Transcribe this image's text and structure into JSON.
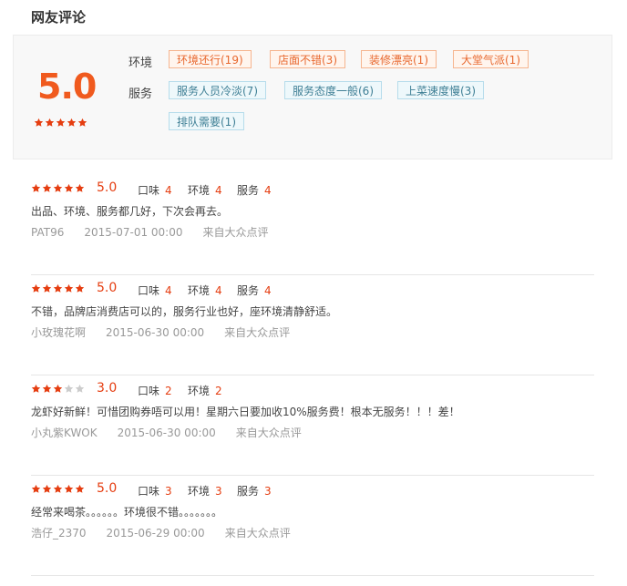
{
  "section_title": "网友评论",
  "summary": {
    "overall_score": "5.0",
    "overall_stars": 5,
    "environment_label": "环境",
    "service_label": "服务",
    "environment_tags": [
      "环境还行(19)",
      "店面不错(3)",
      "装修漂亮(1)",
      "大堂气派(1)"
    ],
    "service_tags": [
      "服务人员冷淡(7)",
      "服务态度一般(6)",
      "上菜速度慢(3)",
      "排队需要(1)"
    ]
  },
  "colors": {
    "accent": "#e53d10",
    "star_on": "#e53d10",
    "star_off": "#cccccc"
  },
  "reviews": [
    {
      "stars": 5,
      "score": "5.0",
      "metrics": [
        {
          "label": "口味",
          "value": "4"
        },
        {
          "label": "环境",
          "value": "4"
        },
        {
          "label": "服务",
          "value": "4"
        }
      ],
      "text": "出品、环境、服务都几好，下次会再去。",
      "user": "PAT96",
      "time": "2015-07-01 00:00",
      "source": "来自大众点评"
    },
    {
      "stars": 5,
      "score": "5.0",
      "metrics": [
        {
          "label": "口味",
          "value": "4"
        },
        {
          "label": "环境",
          "value": "4"
        },
        {
          "label": "服务",
          "value": "4"
        }
      ],
      "text": "不错，品牌店消费店可以的，服务行业也好，座环境清静舒适。",
      "user": "小玫瑰花啊",
      "time": "2015-06-30 00:00",
      "source": "来自大众点评"
    },
    {
      "stars": 3,
      "score": "3.0",
      "metrics": [
        {
          "label": "口味",
          "value": "2"
        },
        {
          "label": "环境",
          "value": "2"
        }
      ],
      "text": "龙虾好新鲜！可惜团购券唔可以用！星期六日要加收10%服务费！根本无服务！！！差！",
      "user": "小丸紫KWOK",
      "time": "2015-06-30 00:00",
      "source": "来自大众点评"
    },
    {
      "stars": 5,
      "score": "5.0",
      "metrics": [
        {
          "label": "口味",
          "value": "3"
        },
        {
          "label": "环境",
          "value": "3"
        },
        {
          "label": "服务",
          "value": "3"
        }
      ],
      "text": "经常来喝茶。。。。。。环境很不错。。。。。。。",
      "user": "浩仔_2370",
      "time": "2015-06-29 00:00",
      "source": "来自大众点评"
    }
  ]
}
